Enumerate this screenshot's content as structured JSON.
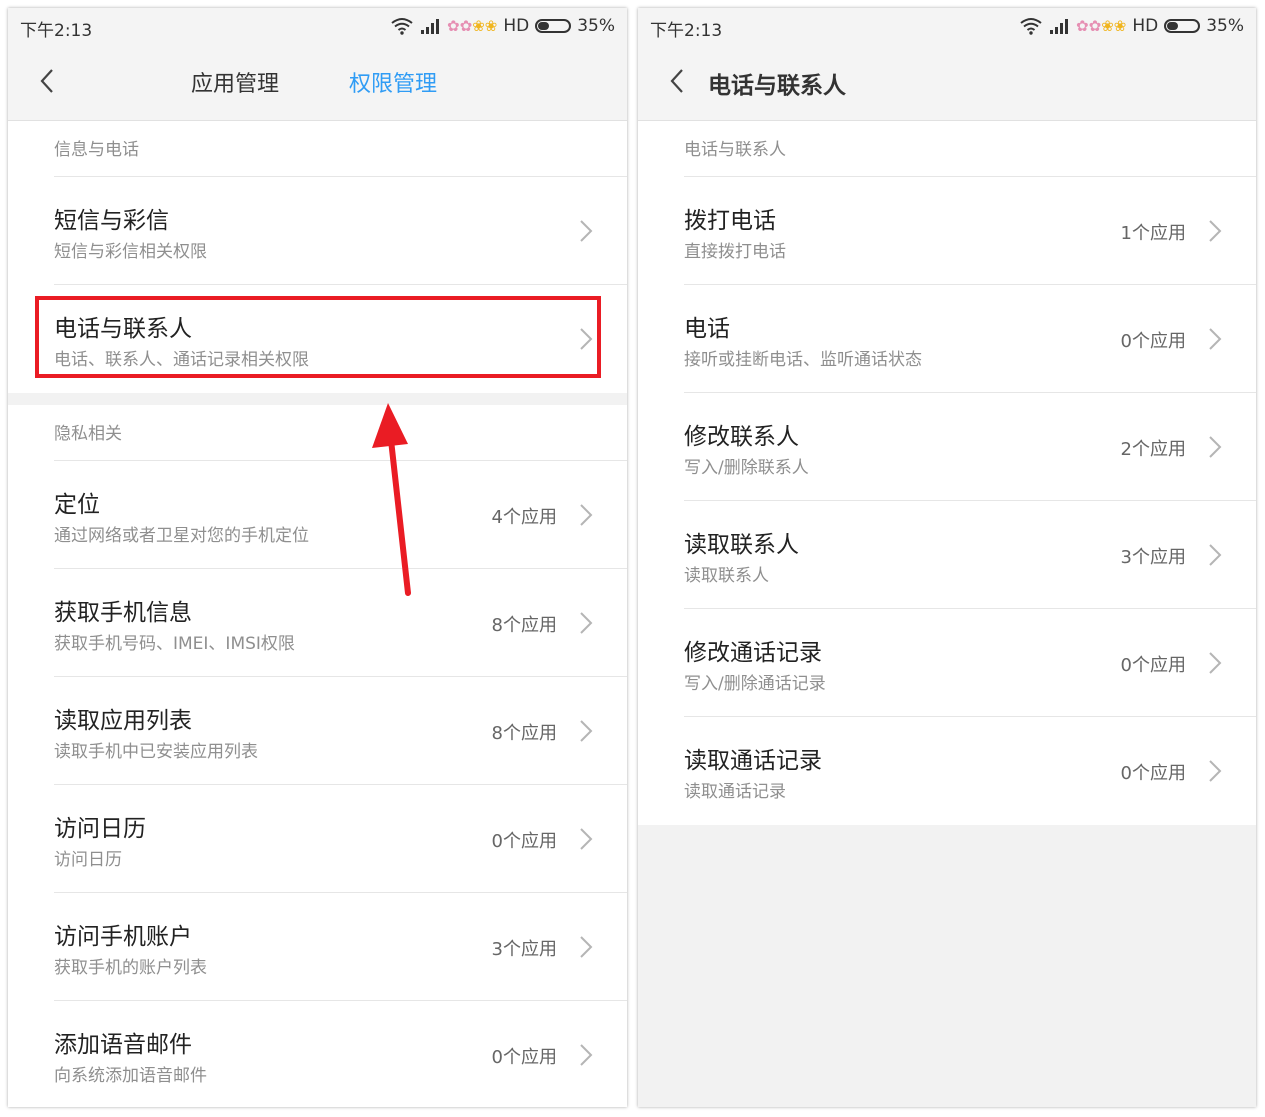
{
  "left": {
    "status": {
      "time": "下午2:13",
      "network": "HD",
      "battery": "35%"
    },
    "nav": {
      "tab1": "应用管理",
      "tab2": "权限管理"
    },
    "section1": {
      "header": "信息与电话",
      "items": [
        {
          "title": "短信与彩信",
          "sub": "短信与彩信相关权限"
        },
        {
          "title": "电话与联系人",
          "sub": "电话、联系人、通话记录相关权限"
        }
      ]
    },
    "section2": {
      "header": "隐私相关",
      "items": [
        {
          "title": "定位",
          "sub": "通过网络或者卫星对您的手机定位",
          "count": "4个应用"
        },
        {
          "title": "获取手机信息",
          "sub": "获取手机号码、IMEI、IMSI权限",
          "count": "8个应用"
        },
        {
          "title": "读取应用列表",
          "sub": "读取手机中已安装应用列表",
          "count": "8个应用"
        },
        {
          "title": "访问日历",
          "sub": "访问日历",
          "count": "0个应用"
        },
        {
          "title": "访问手机账户",
          "sub": "获取手机的账户列表",
          "count": "3个应用"
        },
        {
          "title": "添加语音邮件",
          "sub": "向系统添加语音邮件",
          "count": "0个应用"
        }
      ]
    }
  },
  "right": {
    "status": {
      "time": "下午2:13",
      "network": "HD",
      "battery": "35%"
    },
    "nav": {
      "title": "电话与联系人"
    },
    "section": {
      "header": "电话与联系人",
      "items": [
        {
          "title": "拨打电话",
          "sub": "直接拨打电话",
          "count": "1个应用"
        },
        {
          "title": "电话",
          "sub": "接听或挂断电话、监听通话状态",
          "count": "0个应用"
        },
        {
          "title": "修改联系人",
          "sub": "写入/删除联系人",
          "count": "2个应用"
        },
        {
          "title": "读取联系人",
          "sub": "读取联系人",
          "count": "3个应用"
        },
        {
          "title": "修改通话记录",
          "sub": "写入/删除通话记录",
          "count": "0个应用"
        },
        {
          "title": "读取通话记录",
          "sub": "读取通话记录",
          "count": "0个应用"
        }
      ]
    }
  },
  "colors": {
    "accent": "#2f9cf5",
    "highlight": "#ea1c24",
    "text": "#222222",
    "subtext": "#8f8f8f"
  },
  "icons": [
    "back-arrow-icon",
    "chevron-right-icon",
    "wifi-icon",
    "signal-icon",
    "battery-icon",
    "flower-icon"
  ]
}
